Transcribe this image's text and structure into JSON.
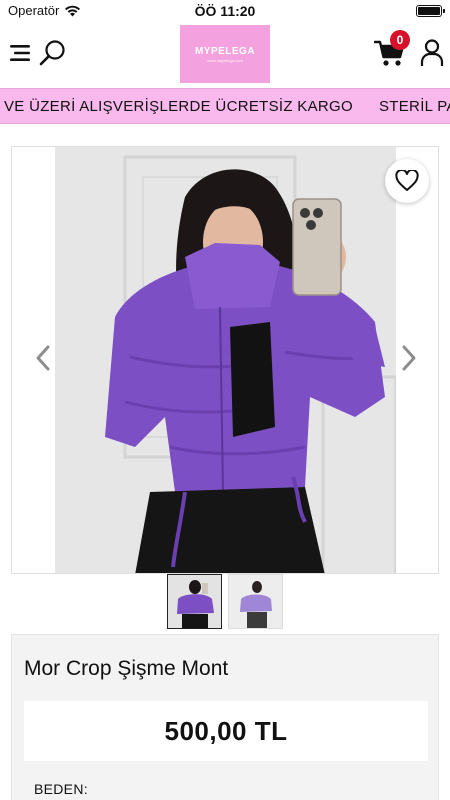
{
  "status_bar": {
    "carrier": "Operatör",
    "time": "ÖÖ 11:20"
  },
  "header": {
    "logo_text": "MYPELEGA",
    "logo_sub": "www.mypelega.com",
    "cart_count": "0",
    "brand_color": "#f3a2df"
  },
  "banner": {
    "messages": [
      "VE ÜZERİ ALIŞVERİŞLERDE ÜCRETSİZ KARGO",
      "STERİL PAKETLEME"
    ],
    "background": "#f9b9ec"
  },
  "product": {
    "title": "Mor Crop Şişme Mont",
    "price": "500,00 TL",
    "size_label": "BEDEN:",
    "thumbnail_count": 2,
    "active_thumbnail": 0,
    "jacket_color": "#7d4fc4"
  },
  "icons": {
    "menu": "menu-icon",
    "search": "search-icon",
    "cart": "cart-icon",
    "user": "user-icon",
    "wishlist": "heart-icon",
    "prev": "chevron-left-icon",
    "next": "chevron-right-icon"
  }
}
